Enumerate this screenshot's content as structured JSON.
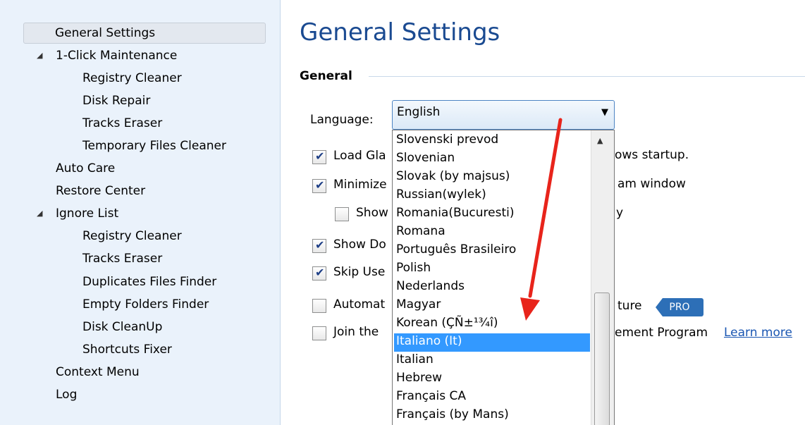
{
  "sidebar": {
    "items": [
      {
        "label": "General Settings"
      },
      {
        "label": "1-Click Maintenance"
      },
      {
        "label": "Registry Cleaner"
      },
      {
        "label": "Disk Repair"
      },
      {
        "label": "Tracks Eraser"
      },
      {
        "label": "Temporary Files Cleaner"
      },
      {
        "label": "Auto Care"
      },
      {
        "label": "Restore Center"
      },
      {
        "label": "Ignore List"
      },
      {
        "label": "Registry Cleaner"
      },
      {
        "label": "Tracks Eraser"
      },
      {
        "label": "Duplicates Files Finder"
      },
      {
        "label": "Empty Folders Finder"
      },
      {
        "label": "Disk CleanUp"
      },
      {
        "label": "Shortcuts Fixer"
      },
      {
        "label": "Context Menu"
      },
      {
        "label": "Log"
      }
    ],
    "expander_glyph": "◢"
  },
  "main": {
    "title": "General Settings",
    "group_label": "General",
    "language": {
      "label": "Language:",
      "value": "English",
      "arrow": "▼"
    },
    "options": [
      {
        "label_prefix": "Load Gla",
        "label_tail": "ows startup.",
        "checked": true
      },
      {
        "label_prefix": "Minimize",
        "label_tail": "am window",
        "checked": true
      },
      {
        "label_prefix": "Show",
        "label_tail": "y",
        "checked": false
      },
      {
        "label_prefix": "Show Do",
        "label_tail": "",
        "checked": true
      },
      {
        "label_prefix": "Skip Use",
        "label_tail": "",
        "checked": true
      },
      {
        "label_prefix": "Automat",
        "label_tail": "ture",
        "checked": false
      },
      {
        "label_prefix": "Join the",
        "label_tail": "ement Program",
        "checked": false
      }
    ],
    "pro_badge": "PRO",
    "learn_more": "Learn more",
    "check_glyph": "✔"
  },
  "dropdown": {
    "items": [
      "Slovenski prevod",
      "Slovenian",
      "Slovak (by majsus)",
      "Russian(wylek)",
      "Romania(Bucuresti)",
      "Romana",
      "Português Brasileiro",
      "Polish",
      "Nederlands",
      "Magyar",
      "Korean (ÇÑ±¹¾î)",
      "Italiano (It)",
      "Italian",
      "Hebrew",
      "Français CA",
      "Français (by Mans)"
    ],
    "selected_index": 11,
    "scroll_up_glyph": "▲"
  },
  "colors": {
    "title": "#1a4a91",
    "sidebar_bg": "#eaf2fb",
    "selection": "#3399ff",
    "arrow": "#e8241b",
    "pro_badge": "#2d6fb7"
  }
}
